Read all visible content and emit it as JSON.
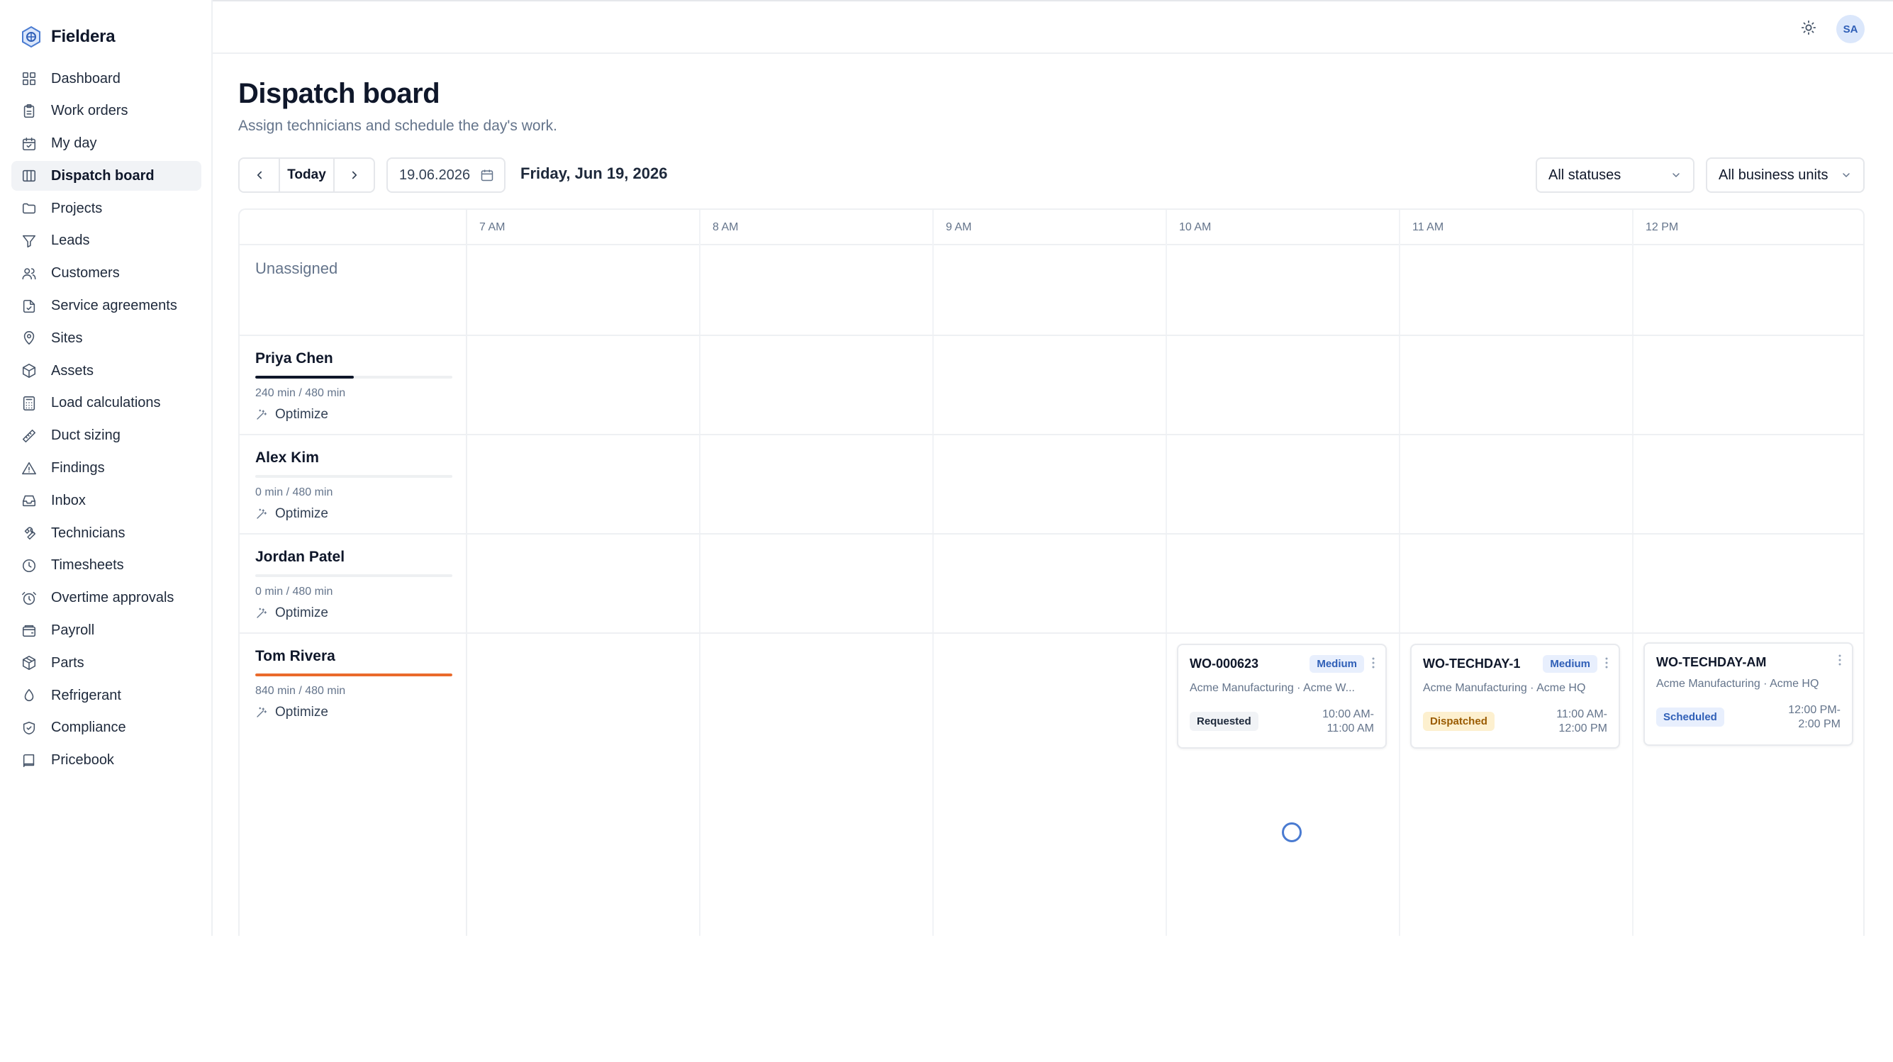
{
  "app": {
    "name": "Fieldera"
  },
  "sidebar": {
    "items": [
      {
        "label": "Dashboard",
        "icon": "dashboard-icon",
        "active": false
      },
      {
        "label": "Work orders",
        "icon": "clipboard-icon",
        "active": false
      },
      {
        "label": "My day",
        "icon": "calendar-check-icon",
        "active": false
      },
      {
        "label": "Dispatch board",
        "icon": "columns-icon",
        "active": true
      },
      {
        "label": "Projects",
        "icon": "folder-icon",
        "active": false
      },
      {
        "label": "Leads",
        "icon": "funnel-icon",
        "active": false
      },
      {
        "label": "Customers",
        "icon": "users-icon",
        "active": false
      },
      {
        "label": "Service agreements",
        "icon": "document-check-icon",
        "active": false
      },
      {
        "label": "Sites",
        "icon": "map-pin-icon",
        "active": false
      },
      {
        "label": "Assets",
        "icon": "box-icon",
        "active": false
      },
      {
        "label": "Load calculations",
        "icon": "calculator-icon",
        "active": false
      },
      {
        "label": "Duct sizing",
        "icon": "ruler-icon",
        "active": false
      },
      {
        "label": "Findings",
        "icon": "warning-icon",
        "active": false
      },
      {
        "label": "Inbox",
        "icon": "inbox-icon",
        "active": false
      },
      {
        "label": "Technicians",
        "icon": "wrench-icon",
        "active": false
      },
      {
        "label": "Timesheets",
        "icon": "clock-icon",
        "active": false
      },
      {
        "label": "Overtime approvals",
        "icon": "alarm-clock-icon",
        "active": false
      },
      {
        "label": "Payroll",
        "icon": "wallet-icon",
        "active": false
      },
      {
        "label": "Parts",
        "icon": "package-icon",
        "active": false
      },
      {
        "label": "Refrigerant",
        "icon": "droplet-icon",
        "active": false
      },
      {
        "label": "Compliance",
        "icon": "shield-check-icon",
        "active": false
      },
      {
        "label": "Pricebook",
        "icon": "book-icon",
        "active": false
      }
    ]
  },
  "header": {
    "avatar_initials": "SA"
  },
  "page": {
    "title": "Dispatch board",
    "subtitle": "Assign technicians and schedule the day's work.",
    "today_label": "Today",
    "date_value": "19.06.2026",
    "date_long": "Friday, Jun 19, 2026",
    "status_filter": "All statuses",
    "business_unit_filter": "All business units"
  },
  "board": {
    "hours": [
      "7 AM",
      "8 AM",
      "9 AM",
      "10 AM",
      "11 AM",
      "12 PM"
    ],
    "unassigned_label": "Unassigned",
    "optimize_label": "Optimize",
    "technicians": [
      {
        "name": "Priya Chen",
        "capacity": "240 min / 480 min",
        "used_fraction": 0.5,
        "bar_color": "#0f172a"
      },
      {
        "name": "Alex Kim",
        "capacity": "0 min / 480 min",
        "used_fraction": 0,
        "bar_color": "#0f172a"
      },
      {
        "name": "Jordan Patel",
        "capacity": "0 min / 480 min",
        "used_fraction": 0,
        "bar_color": "#0f172a"
      },
      {
        "name": "Tom Rivera",
        "capacity": "840 min / 480 min",
        "used_fraction": 1,
        "bar_color": "#ea6a2b"
      }
    ],
    "cards": [
      {
        "id": "WO-000623",
        "priority": "Medium",
        "customer": "Acme Manufacturing · Acme W...",
        "status": "Requested",
        "status_bg": "#f1f3f6",
        "status_fg": "#1e293b",
        "time_1": "10:00 AM-",
        "time_2": "11:00 AM"
      },
      {
        "id": "WO-TECHDAY-1",
        "priority": "Medium",
        "customer": "Acme Manufacturing · Acme HQ",
        "status": "Dispatched",
        "status_bg": "#fdf0cf",
        "status_fg": "#9a5b00",
        "time_1": "11:00 AM-",
        "time_2": "12:00 PM"
      },
      {
        "id": "WO-TECHDAY-AM",
        "priority": "",
        "customer": "Acme Manufacturing · Acme HQ",
        "status": "Scheduled",
        "status_bg": "#e8effd",
        "status_fg": "#2f5fb7",
        "time_1": "12:00 PM-",
        "time_2": "2:00 PM"
      }
    ]
  }
}
